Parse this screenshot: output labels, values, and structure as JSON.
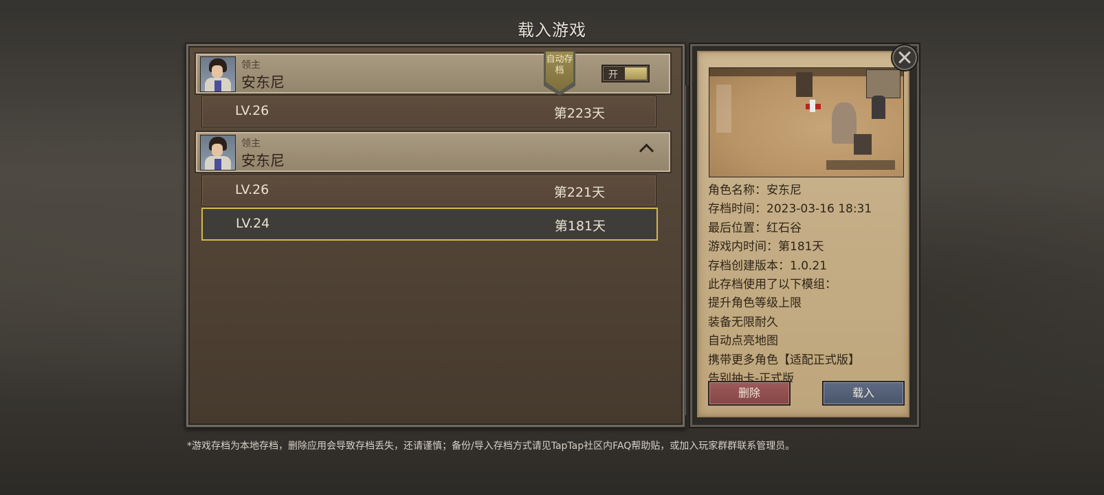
{
  "title": "载入游戏",
  "groups": [
    {
      "rank": "领主",
      "name": "安东尼",
      "autosave_label": "自动存档",
      "autosave_toggle": "开",
      "saves": [
        {
          "level": "LV.26",
          "day": "第223天"
        }
      ]
    },
    {
      "rank": "领主",
      "name": "安东尼",
      "expanded": true,
      "saves": [
        {
          "level": "LV.26",
          "day": "第221天"
        },
        {
          "level": "LV.24",
          "day": "第181天",
          "selected": true
        }
      ]
    }
  ],
  "details": {
    "lines": [
      "角色名称：安东尼",
      "存档时间：2023-03-16 18:31",
      "最后位置：红石谷",
      "游戏内时间：第181天",
      "存档创建版本：1.0.21",
      "此存档使用了以下模组：",
      "提升角色等级上限",
      "装备无限耐久",
      "自动点亮地图",
      "携带更多角色【适配正式版】",
      "告别抽卡-正式版"
    ],
    "delete_label": "删除",
    "load_label": "载入"
  },
  "footer_note": "*游戏存档为本地存档，删除应用会导致存档丢失，还请谨慎；备份/导入存档方式请见TapTap社区内FAQ帮助贴，或加入玩家群群联系管理员。",
  "colors": {
    "selected_border": "#d3b84b",
    "delete_button": "#9e5a5a",
    "load_button": "#5d6a82"
  },
  "icons": [
    "close-icon",
    "chevron-up-icon",
    "avatar-portrait"
  ]
}
